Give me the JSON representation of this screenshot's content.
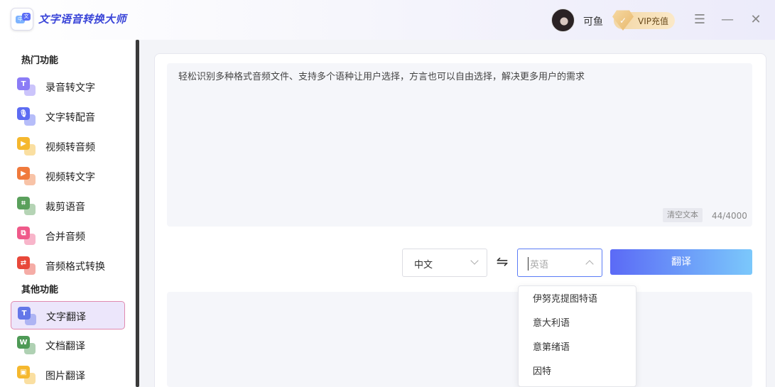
{
  "app": {
    "title": "文字语音转换大师",
    "logo_text_a": "中",
    "logo_text_b": "文"
  },
  "user": {
    "name": "可鱼",
    "vip_label": "VIP充值"
  },
  "window_controls": {
    "menu": "☰",
    "minimize": "—",
    "close": "✕"
  },
  "sidebar": {
    "hot_title": "热门功能",
    "other_title": "其他功能",
    "hot_items": [
      {
        "label": "录音转文字",
        "icon": "transcribe-icon",
        "glyph": "T",
        "color": "#8b7cf6"
      },
      {
        "label": "文字转配音",
        "icon": "microphone-icon",
        "glyph": "🎙",
        "color": "#5d6cf2"
      },
      {
        "label": "视频转音频",
        "icon": "video-play-icon",
        "glyph": "▶",
        "color": "#f5b82e"
      },
      {
        "label": "视频转文字",
        "icon": "video-text-icon",
        "glyph": "▶",
        "color": "#f07a3c"
      },
      {
        "label": "裁剪语音",
        "icon": "crop-icon",
        "glyph": "⌗",
        "color": "#5aa05c"
      },
      {
        "label": "合并音频",
        "icon": "merge-icon",
        "glyph": "⧉",
        "color": "#ef5a8a"
      },
      {
        "label": "音频格式转换",
        "icon": "convert-icon",
        "glyph": "⇄",
        "color": "#e8483a"
      }
    ],
    "other_items": [
      {
        "label": "文字翻译",
        "icon": "text-translate-icon",
        "glyph": "T",
        "color": "#6477e8",
        "active": true
      },
      {
        "label": "文档翻译",
        "icon": "document-icon",
        "glyph": "W",
        "color": "#4e9a56"
      },
      {
        "label": "图片翻译",
        "icon": "image-icon",
        "glyph": "▣",
        "color": "#f5b82e"
      }
    ]
  },
  "editor": {
    "input_text": "轻松识别多种格式音频文件、支持多个语种让用户选择，方言也可以自由选择，解决更多用户的需求",
    "clear_label": "清空文本",
    "char_count": "44/4000"
  },
  "translate_bar": {
    "source_lang": "中文",
    "target_placeholder": "英语",
    "swap_glyph": "⇋",
    "translate_label": "翻译"
  },
  "language_dropdown": {
    "options": [
      "伊努克提图特语",
      "意大利语",
      "意第绪语",
      "因特"
    ]
  }
}
